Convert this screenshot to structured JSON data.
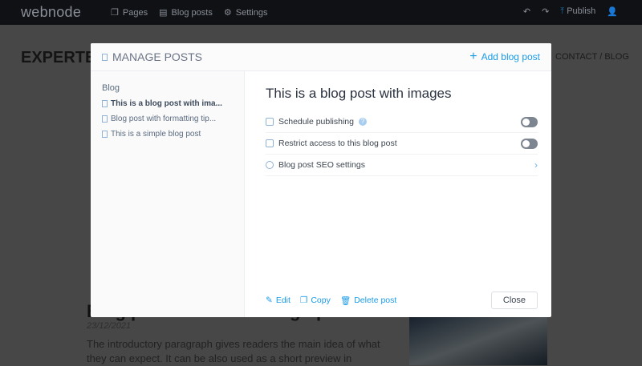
{
  "topbar": {
    "logo": "webnode",
    "nav": [
      "Pages",
      "Blog posts",
      "Settings"
    ],
    "publish": "Publish"
  },
  "page": {
    "brand": "EXPERTE",
    "menu": "CONTACT / BLOG",
    "heading": "Blog post with formatting tips",
    "date": "23/12/2021",
    "paragraph": "The introductory paragraph gives readers the main idea of what they can expect. It can be also used as a short preview in"
  },
  "modal": {
    "title": "MANAGE POSTS",
    "add": "Add blog post",
    "sidebar": {
      "category": "Blog",
      "items": [
        "This is a blog post with ima...",
        "Blog post with formatting tip...",
        "This is a simple blog post"
      ]
    },
    "post_title": "This is a blog post with images",
    "settings": [
      "Schedule publishing",
      "Restrict access to this blog post",
      "Blog post SEO settings"
    ],
    "help": "?",
    "actions": {
      "edit": "Edit",
      "copy": "Copy",
      "delete": "Delete post",
      "close": "Close"
    }
  }
}
